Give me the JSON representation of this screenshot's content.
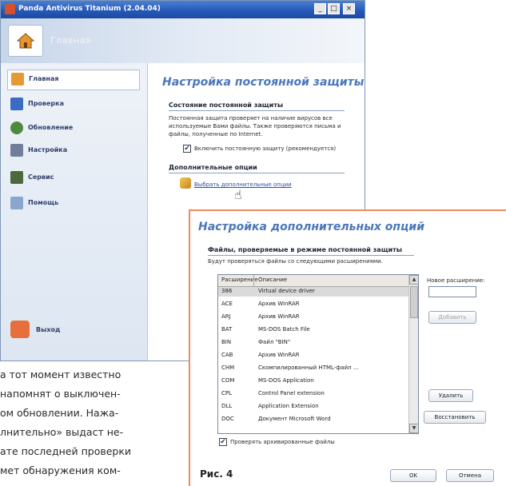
{
  "window": {
    "title": "Panda Antivirus Titanium (2.04.04)",
    "header_label": "Главная",
    "controls": {
      "min": "_",
      "max": "□",
      "close": "×"
    }
  },
  "sidebar": {
    "items": [
      {
        "label": "Главная",
        "icon": "home-icon"
      },
      {
        "label": "Проверка",
        "icon": "scan-icon"
      },
      {
        "label": "Обновление",
        "icon": "update-icon"
      },
      {
        "label": "Настройка",
        "icon": "settings-icon"
      },
      {
        "label": "Сервис",
        "icon": "service-icon"
      },
      {
        "label": "Помощь",
        "icon": "help-icon"
      }
    ],
    "exit_label": "Выход"
  },
  "content": {
    "title": "Настройка постоянной защиты",
    "section1_title": "Состояние постоянной защиты",
    "section1_desc": "Постоянная защита проверяет на наличие вирусов все используемые Вами файлы. Также проверяются письма и файлы, полученные по Internet.",
    "enable_label": "Включить постоянную защиту (рекомендуется)",
    "enable_checked": true,
    "section2_title": "Дополнительные опции",
    "options_link": "Выбрать дополнительные опции"
  },
  "article": {
    "lines": [
      "а тот момент известно",
      "напомнят о выключен-",
      "ом обновлении. Нажа-",
      "лнительно» выдаст не-",
      "ате последней проверки",
      "мет обнаружения ком-"
    ]
  },
  "dialog": {
    "title": "Настройка дополнительных опций",
    "section_title": "Файлы, проверяемые в режиме постоянной защиты",
    "subtitle": "Будут проверяться файлы со следующими расширениями.",
    "columns": [
      "Расширение",
      "Описание"
    ],
    "rows": [
      {
        "ext": "386",
        "desc": "Virtual device driver"
      },
      {
        "ext": "ACE",
        "desc": "Архив WinRAR"
      },
      {
        "ext": "ARJ",
        "desc": "Архив WinRAR"
      },
      {
        "ext": "BAT",
        "desc": "MS-DOS Batch File"
      },
      {
        "ext": "BIN",
        "desc": "Файл \"BIN\""
      },
      {
        "ext": "CAB",
        "desc": "Архив WinRAR"
      },
      {
        "ext": "CHM",
        "desc": "Скомпилированный HTML-файл ..."
      },
      {
        "ext": "COM",
        "desc": "MS-DOS Application"
      },
      {
        "ext": "CPL",
        "desc": "Control Panel extension"
      },
      {
        "ext": "DLL",
        "desc": "Application Extension"
      },
      {
        "ext": "DOC",
        "desc": "Документ Microsoft Word"
      }
    ],
    "selected_row": 0,
    "new_ext_label": "Новое расширение:",
    "new_ext_value": "",
    "add_button": "Добавить",
    "delete_button": "Удалить",
    "restore_button": "Восстановить",
    "archives_label": "Проверять архивированные файлы",
    "archives_checked": true,
    "ok_button": "OK",
    "cancel_button": "Отмена"
  },
  "figure_caption": "Рис. 4",
  "colors": {
    "accent": "#4a77b8",
    "dialog_border": "#f08a5a",
    "titlebar": "#2457b5"
  }
}
